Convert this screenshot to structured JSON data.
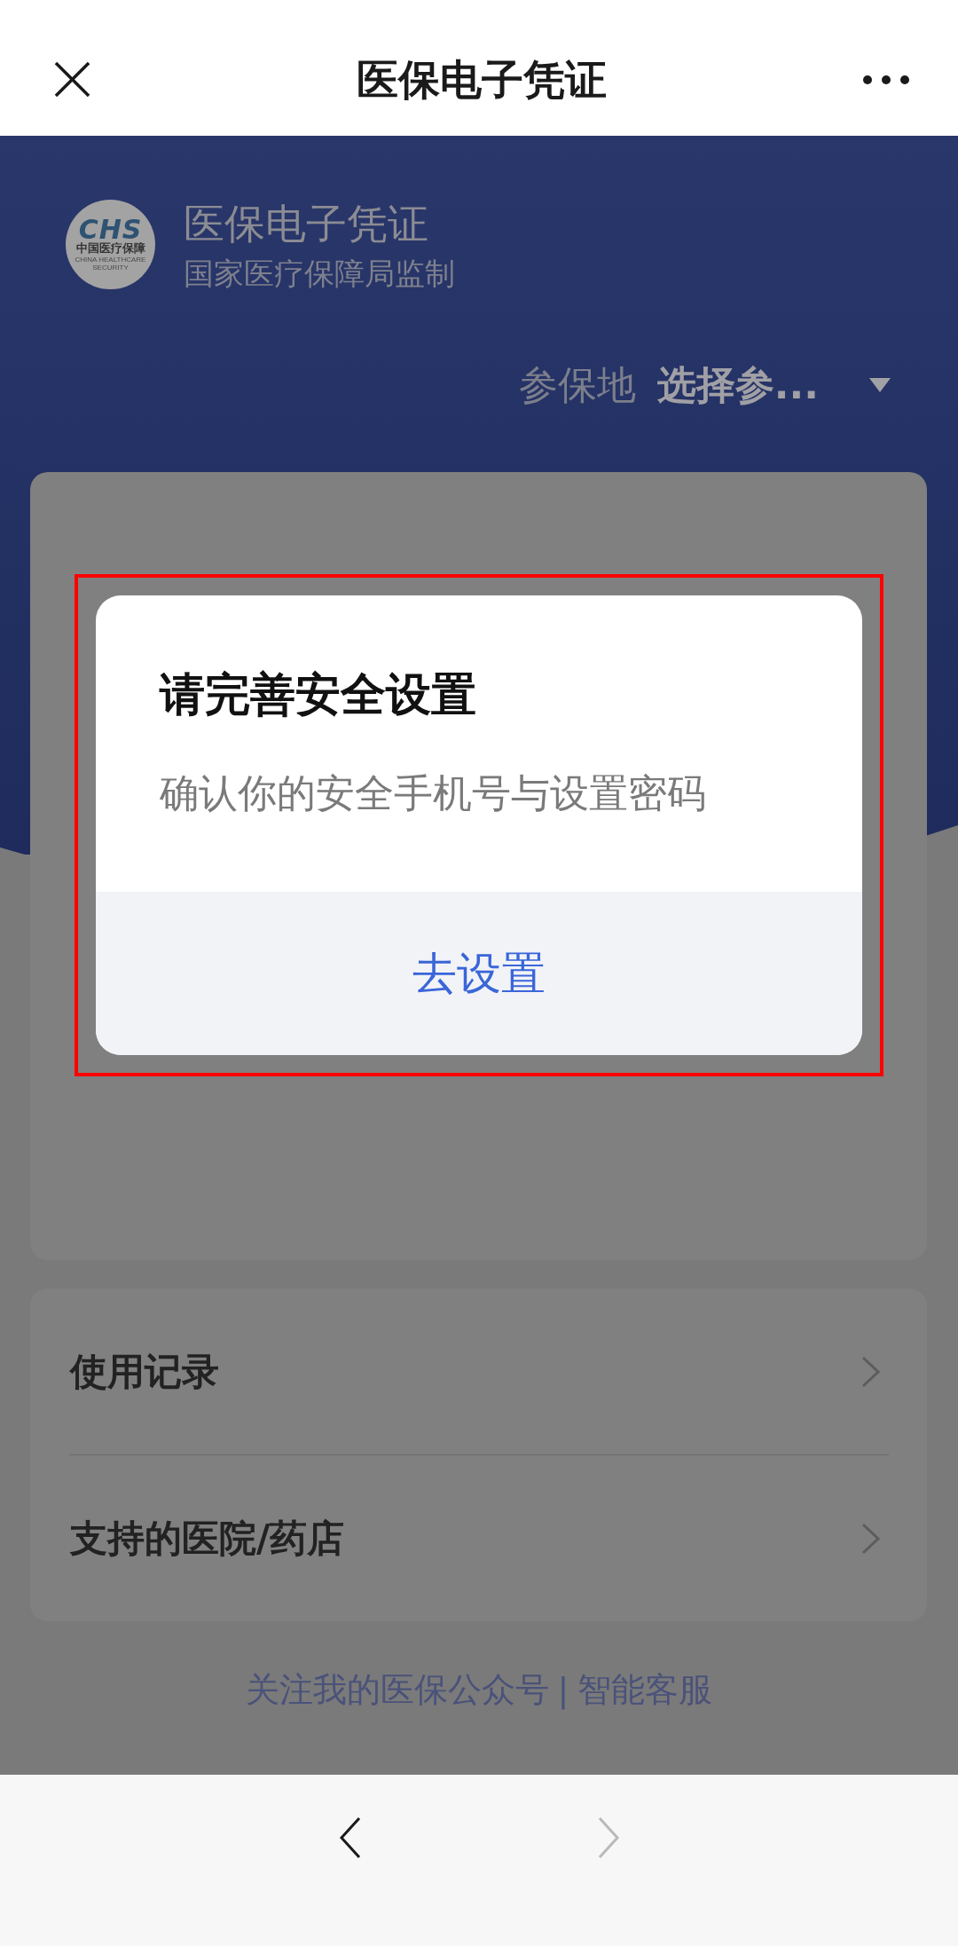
{
  "nav_bar": {
    "title": "医保电子凭证"
  },
  "header": {
    "logo": {
      "mark": "CHS",
      "name": "中国医疗保障",
      "name_en": "CHINA HEALTHCARE SECURITY"
    },
    "title": "医保电子凭证",
    "subtitle": "国家医疗保障局监制"
  },
  "location": {
    "label": "参保地",
    "value": "选择参..."
  },
  "menu_items": [
    {
      "label": "使用记录"
    },
    {
      "label": "支持的医院/药店"
    }
  ],
  "footer": {
    "links": [
      "关注我的医保公众号",
      "智能客服"
    ],
    "separator": "|"
  },
  "dialog": {
    "title": "请完善安全设置",
    "message": "确认你的安全手机号与设置密码",
    "button": "去设置"
  },
  "browser_bar": {
    "back": {
      "disabled": false
    },
    "forward": {
      "disabled": true
    }
  }
}
